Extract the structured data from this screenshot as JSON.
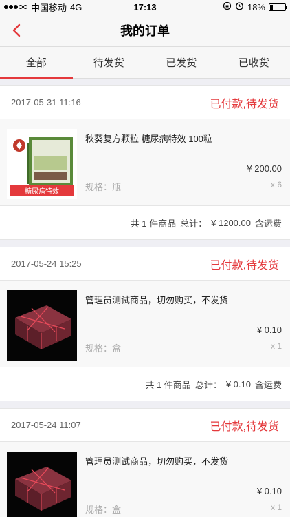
{
  "status": {
    "carrier": "中国移动",
    "network": "4G",
    "time": "17:13",
    "battery": "18%",
    "battery_level": 0.18
  },
  "nav": {
    "title": "我的订单"
  },
  "tabs": [
    {
      "label": "全部"
    },
    {
      "label": "待发货"
    },
    {
      "label": "已发货"
    },
    {
      "label": "已收货"
    }
  ],
  "orders": [
    {
      "date": "2017-05-31 11:16",
      "status": "已付款,待发货",
      "item": {
        "name": "秋葵复方颗粒 糖尿病特效 100粒",
        "price": "¥ 200.00",
        "spec": "规格：瓶",
        "qty": "x 6",
        "badge": "糖尿病特效"
      },
      "summary": {
        "count": "共 1 件商品",
        "total_label": "总计：",
        "total": "¥ 1200.00",
        "shipping": "含运费"
      }
    },
    {
      "date": "2017-05-24 15:25",
      "status": "已付款,待发货",
      "item": {
        "name": "管理员测试商品，切勿购买，不发货",
        "price": "¥ 0.10",
        "spec": "规格：盒",
        "qty": "x 1"
      },
      "summary": {
        "count": "共 1 件商品",
        "total_label": "总计：",
        "total": "¥ 0.10",
        "shipping": "含运费"
      }
    },
    {
      "date": "2017-05-24 11:07",
      "status": "已付款,待发货",
      "item": {
        "name": "管理员测试商品，切勿购买，不发货",
        "price": "¥ 0.10",
        "spec": "规格：盒",
        "qty": "x 1"
      }
    }
  ],
  "colors": {
    "accent": "#e4393c"
  }
}
